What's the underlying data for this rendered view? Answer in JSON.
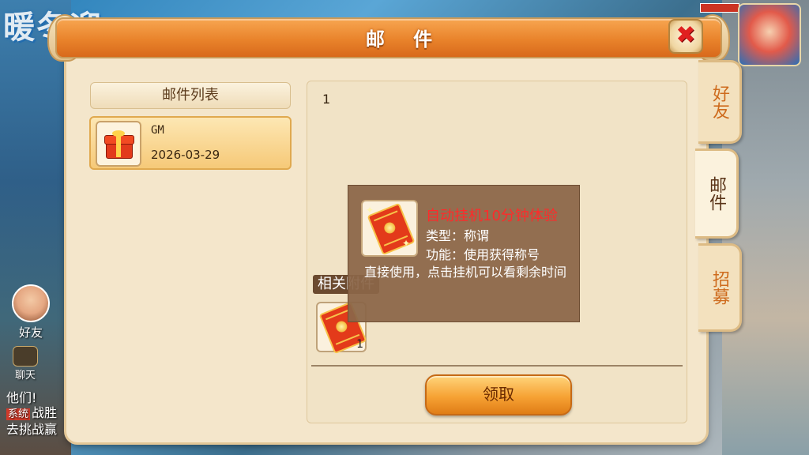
{
  "window": {
    "title": "邮 件",
    "close_label": "✖"
  },
  "side_tabs": [
    {
      "label": "好友",
      "active": false
    },
    {
      "label": "邮件",
      "active": true
    },
    {
      "label": "招募",
      "active": false
    }
  ],
  "mail_list": {
    "header": "邮件列表",
    "items": [
      {
        "sender": "GM",
        "date": "2026-03-29",
        "icon": "gift-icon"
      }
    ]
  },
  "mail_detail": {
    "body": "1",
    "attachments_label": "相关附件",
    "attachment": {
      "icon": "ticket-icon",
      "count": "1"
    },
    "claim_button": "领取"
  },
  "tooltip": {
    "name": "自动挂机10分钟体验",
    "type": "类型：称谓",
    "function": "功能：使用获得称号",
    "description": "直接使用，点击挂机可以看剩余时间",
    "name_color": "#ff2a2a"
  },
  "background": {
    "banner_text": "暖冬迎",
    "hud_friend": "好友",
    "hud_chat": "聊天",
    "chat_lines": [
      "他们!",
      "战胜",
      "去挑战赢"
    ],
    "system_tag": "系统"
  }
}
